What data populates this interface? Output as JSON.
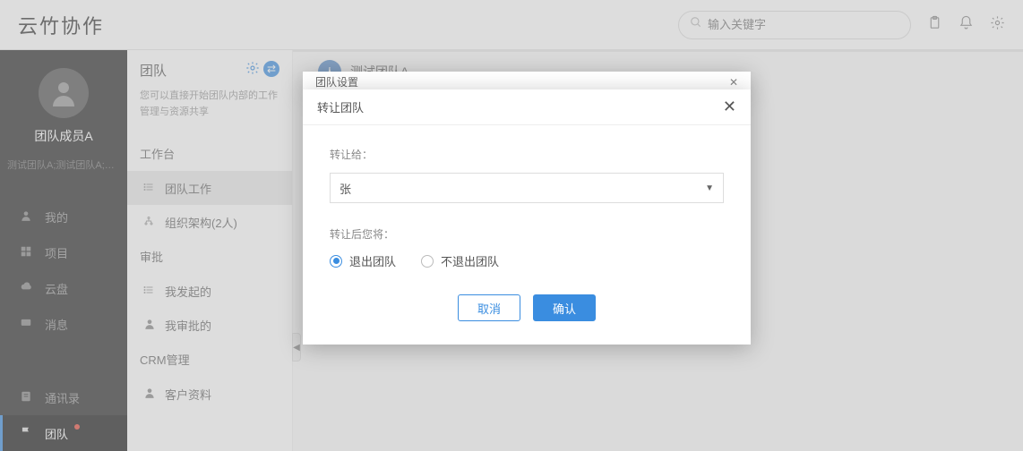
{
  "header": {
    "logo": "云竹协作",
    "search_placeholder": "输入关键字"
  },
  "sidebar": {
    "username": "团队成员A",
    "user_sub": "测试团队A;测试团队A;云竹协…",
    "nav1": [
      {
        "label": "我的",
        "icon": "user"
      },
      {
        "label": "项目",
        "icon": "grid"
      },
      {
        "label": "云盘",
        "icon": "cloud"
      },
      {
        "label": "消息",
        "icon": "message"
      }
    ],
    "nav2": [
      {
        "label": "通讯录",
        "icon": "contacts",
        "active": false
      },
      {
        "label": "团队",
        "icon": "flag",
        "active": true,
        "dot": true
      }
    ]
  },
  "panel": {
    "title": "团队",
    "desc": "您可以直接开始团队内部的工作管理与资源共享",
    "sections": [
      {
        "label": "工作台",
        "items": [
          {
            "label": "团队工作",
            "icon": "list",
            "active": true
          },
          {
            "label": "组织架构(2人)",
            "icon": "org",
            "active": false
          }
        ]
      },
      {
        "label": "审批",
        "items": [
          {
            "label": "我发起的",
            "icon": "list",
            "active": false
          },
          {
            "label": "我审批的",
            "icon": "user",
            "active": false
          }
        ]
      },
      {
        "label": "CRM管理",
        "items": [
          {
            "label": "客户资料",
            "icon": "user",
            "active": false
          }
        ]
      }
    ]
  },
  "main": {
    "team_initial": "人",
    "team_name": "测试团队A",
    "back_modal_title": "团队设置"
  },
  "modal": {
    "title": "转让团队",
    "transfer_to_label": "转让给：",
    "select_value": "张",
    "after_label": "转让后您将：",
    "radio_options": [
      {
        "label": "退出团队",
        "checked": true
      },
      {
        "label": "不退出团队",
        "checked": false
      }
    ],
    "cancel": "取消",
    "confirm": "确认"
  }
}
